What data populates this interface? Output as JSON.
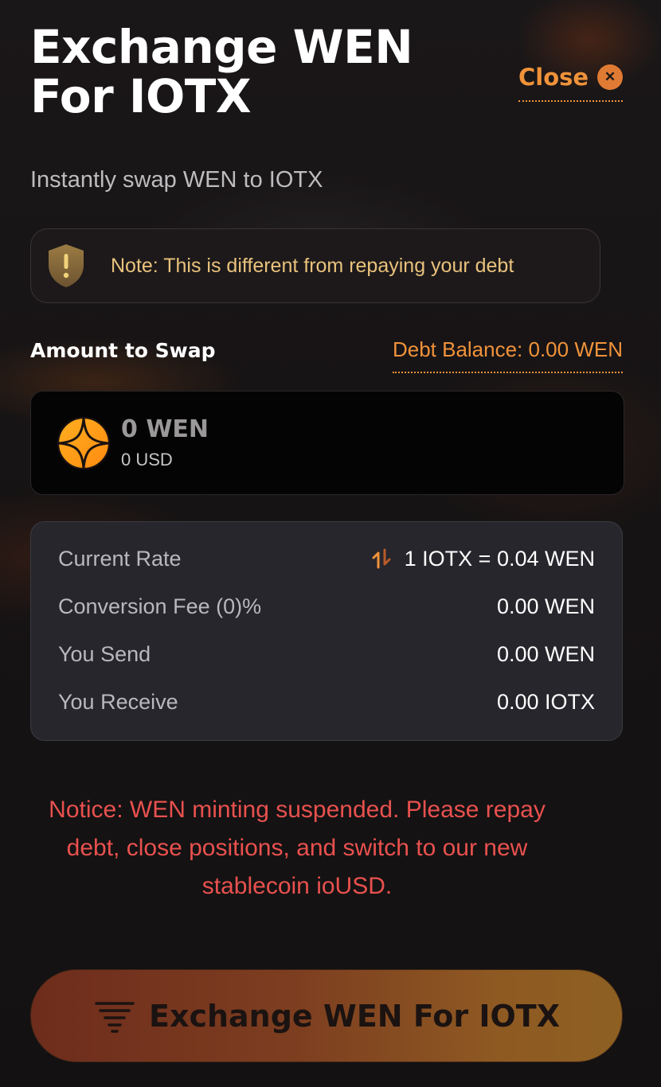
{
  "header": {
    "title": "Exchange WEN For IOTX",
    "close_label": "Close",
    "close_icon": "close-icon"
  },
  "subtitle": "Instantly swap WEN to IOTX",
  "note": {
    "icon": "warning-shield-icon",
    "text": "Note: This is different from repaying your debt"
  },
  "amount": {
    "label": "Amount to Swap",
    "debt_balance": "Debt Balance: 0.00 WEN",
    "token_icon": "wen-token-icon",
    "value": "0 WEN",
    "usd": "0 USD"
  },
  "details": {
    "rows": [
      {
        "key": "Current Rate",
        "value": "1 IOTX = 0.04 WEN",
        "icon": "swap-arrows-icon"
      },
      {
        "key": "Conversion Fee (0)%",
        "value": "0.00 WEN"
      },
      {
        "key": "You Send",
        "value": "0.00 WEN"
      },
      {
        "key": "You Receive",
        "value": "0.00 IOTX"
      }
    ]
  },
  "notice": "Notice: WEN minting suspended. Please repay debt, close positions, and switch to our new stablecoin ioUSD.",
  "cta": {
    "label": "Exchange WEN For IOTX",
    "icon": "tornado-icon"
  },
  "colors": {
    "accent": "#f0923a",
    "note_text": "#e9c27c",
    "notice": "#e8514e",
    "background": "#151213"
  }
}
